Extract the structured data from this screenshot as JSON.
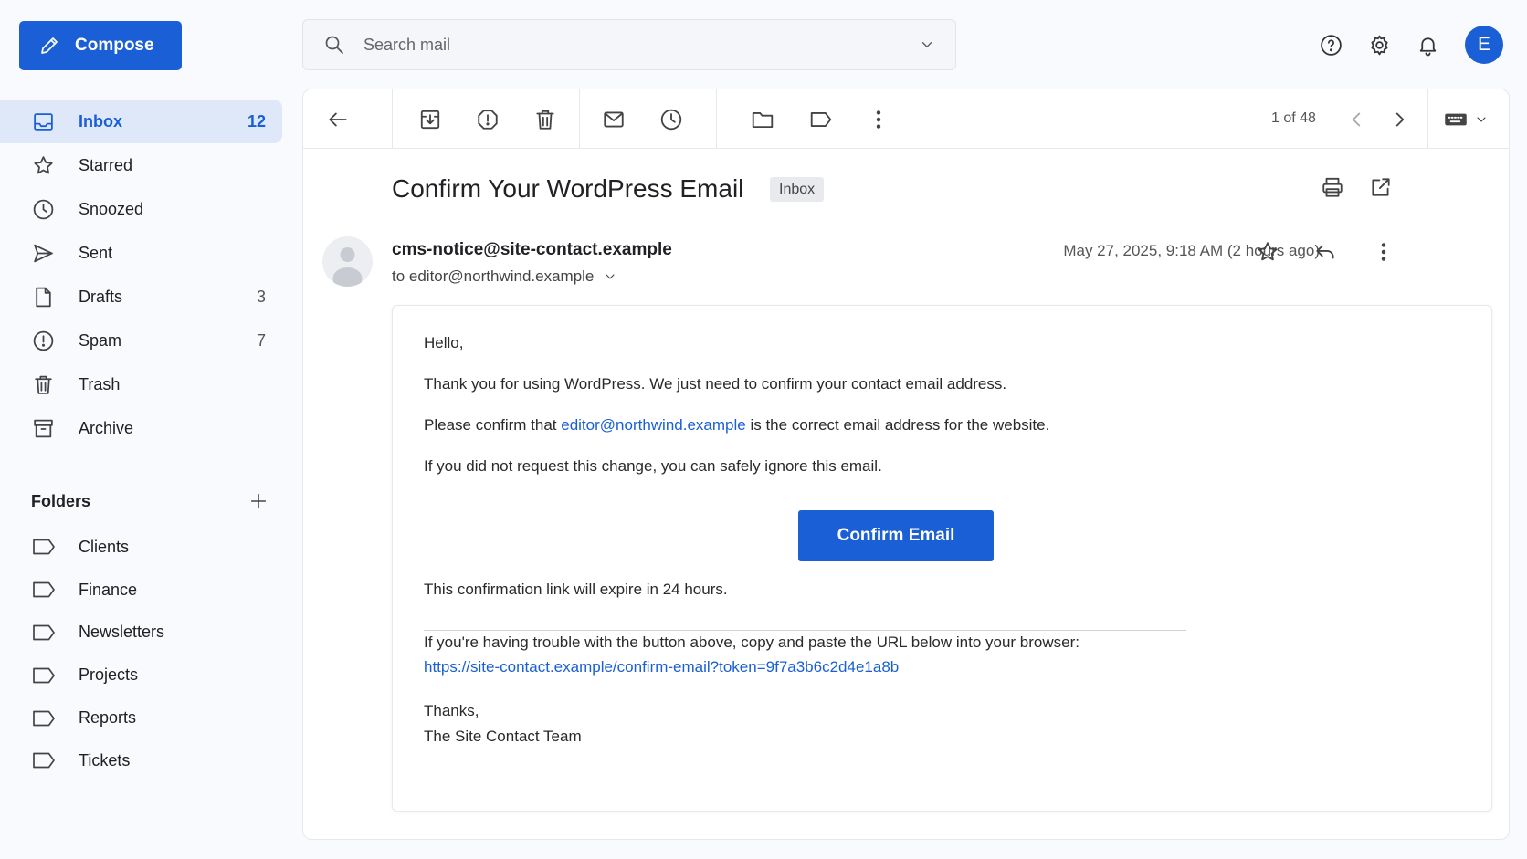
{
  "compose": {
    "label": "Compose"
  },
  "search": {
    "placeholder": "Search mail"
  },
  "user": {
    "initial": "E"
  },
  "nav": [
    {
      "label": "Inbox",
      "count": "12",
      "icon": "inbox-icon",
      "active": true
    },
    {
      "label": "Starred",
      "count": "",
      "icon": "star-icon"
    },
    {
      "label": "Snoozed",
      "count": "",
      "icon": "clock-icon"
    },
    {
      "label": "Sent",
      "count": "",
      "icon": "send-icon"
    },
    {
      "label": "Drafts",
      "count": "3",
      "icon": "file-icon"
    },
    {
      "label": "Spam",
      "count": "7",
      "icon": "alert-circle-icon"
    },
    {
      "label": "Trash",
      "count": "",
      "icon": "trash-icon"
    },
    {
      "label": "Archive",
      "count": "",
      "icon": "archive-icon"
    }
  ],
  "folders": {
    "title": "Folders",
    "items": [
      "Clients",
      "Finance",
      "Newsletters",
      "Projects",
      "Reports",
      "Tickets"
    ]
  },
  "toolbar": {
    "pager": "1 of 48"
  },
  "email": {
    "subject": "Confirm Your WordPress Email",
    "label": "Inbox",
    "sender": "cms-notice@site-contact.example",
    "recipient": "to editor@northwind.example",
    "date": "May 27, 2025, 9:18 AM (2 hours ago)",
    "greeting": "Hello,",
    "para1": "Thank you for using WordPress. We just need to confirm your contact email address.",
    "para2_before": "Please confirm that ",
    "para2_link": "editor@northwind.example",
    "para2_after": " is the correct email address for the website.",
    "para3": "If you did not request this change, you can safely ignore this email.",
    "button": "Confirm Email",
    "expiry": "This confirmation link will expire in 24 hours.",
    "trouble": "If you're having trouble with the button above, copy and paste the URL below into your browser:",
    "url": "https://site-contact.example/confirm-email?token=9f7a3b6c2d4e1a8b",
    "signoff": "Thanks,",
    "signature": "The Site Contact Team"
  },
  "colors": {
    "accent": "#1a5fd6",
    "active_bg": "#dfe8f8"
  }
}
